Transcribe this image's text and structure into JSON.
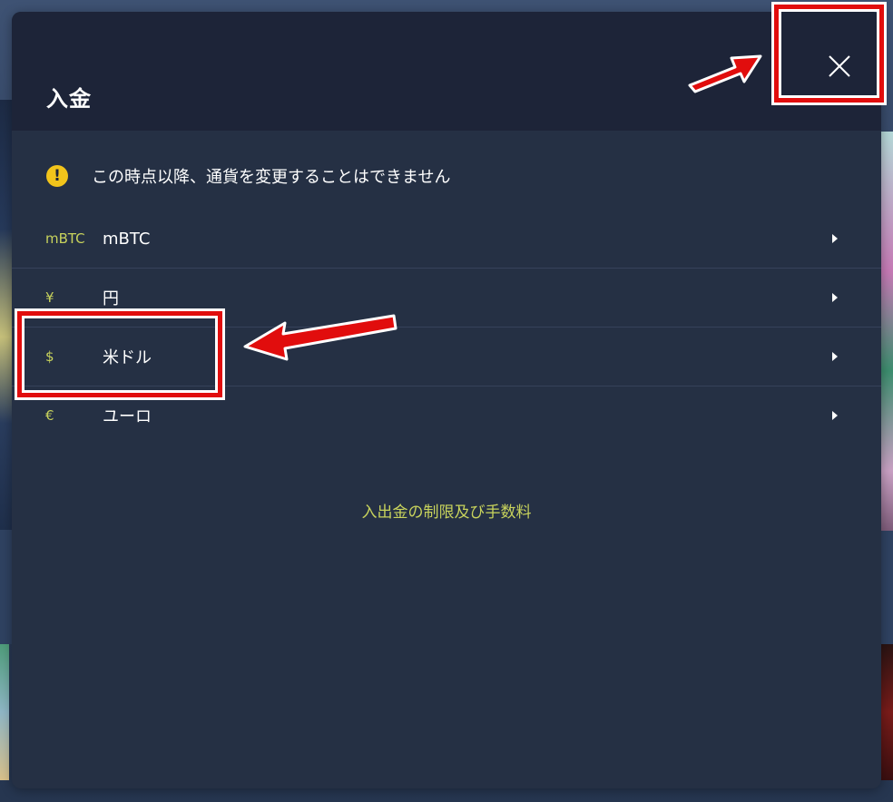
{
  "modal": {
    "title": "入金",
    "notice": "この時点以降、通貨を変更することはできません",
    "currencies": [
      {
        "symbol": "mBTC",
        "name": "mBTC"
      },
      {
        "symbol": "¥",
        "name": "円"
      },
      {
        "symbol": "$",
        "name": "米ドル"
      },
      {
        "symbol": "€",
        "name": "ユーロ"
      }
    ],
    "limits_link": "入出金の制限及び手数料"
  },
  "icons": {
    "close": "close-icon",
    "warning": "warning-icon",
    "chevron": "chevron-right-icon"
  },
  "colors": {
    "modal_bg": "#253044",
    "header_bg": "#1d2438",
    "accent_yellow": "#c8d35c",
    "warning_yellow": "#f2c41b",
    "annotation_red": "#e10d0d"
  }
}
